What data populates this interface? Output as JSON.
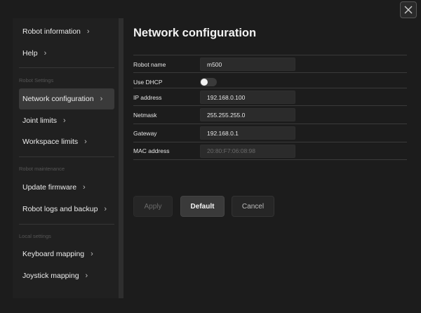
{
  "close": {
    "icon": "close-icon"
  },
  "sidebar": {
    "items_top": [
      {
        "label": "Robot information"
      },
      {
        "label": "Help"
      }
    ],
    "sections": [
      {
        "title": "Robot Settings",
        "items": [
          {
            "label": "Network configuration",
            "active": true
          },
          {
            "label": "Joint limits"
          },
          {
            "label": "Workspace limits"
          }
        ]
      },
      {
        "title": "Robot maintenance",
        "items": [
          {
            "label": "Update firmware"
          },
          {
            "label": "Robot logs and backup"
          }
        ]
      },
      {
        "title": "Local settings",
        "items": [
          {
            "label": "Keyboard mapping"
          },
          {
            "label": "Joystick mapping"
          }
        ]
      }
    ]
  },
  "main": {
    "title": "Network configuration",
    "fields": {
      "robot_name": {
        "label": "Robot name",
        "value": "m500"
      },
      "use_dhcp": {
        "label": "Use DHCP",
        "on": false
      },
      "ip_address": {
        "label": "IP address",
        "value": "192.168.0.100"
      },
      "netmask": {
        "label": "Netmask",
        "value": "255.255.255.0"
      },
      "gateway": {
        "label": "Gateway",
        "value": "192.168.0.1"
      },
      "mac_address": {
        "label": "MAC address",
        "value": "20:80:F7:06:08:98"
      }
    },
    "buttons": {
      "apply": "Apply",
      "default": "Default",
      "cancel": "Cancel"
    }
  },
  "colors": {
    "background": "#1c1c1c",
    "panel": "#202020",
    "active_item": "#3a3a3a",
    "field": "#2b2b2b"
  }
}
